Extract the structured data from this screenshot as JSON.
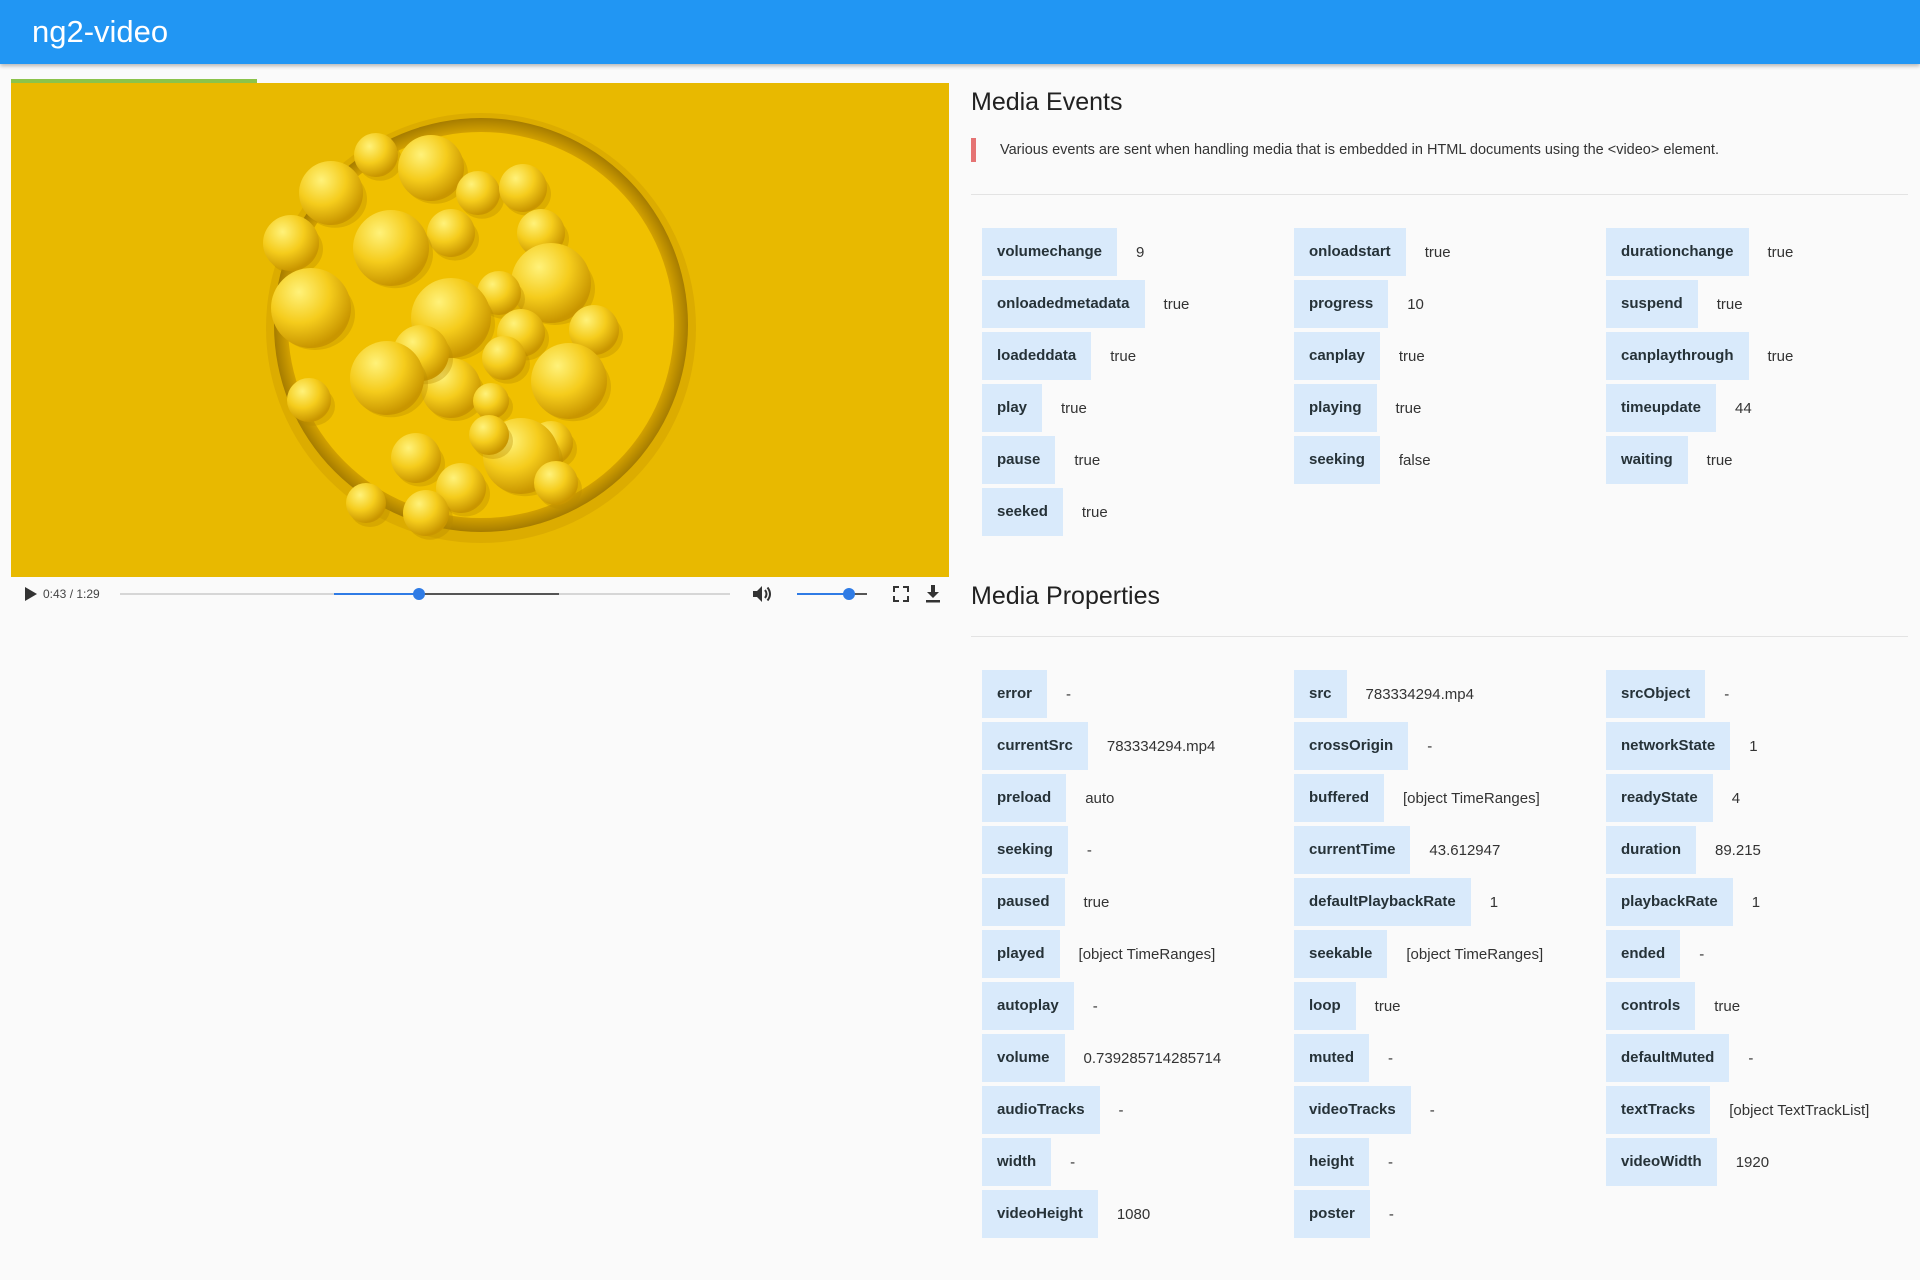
{
  "app": {
    "title": "ng2-video"
  },
  "player": {
    "time_display": "0:43 / 1:29",
    "progress": 0.49,
    "buffered_start": 0.35,
    "buffered_end": 0.72,
    "volume": 0.74
  },
  "events": {
    "title": "Media Events",
    "description": "Various events are sent when handling media that is embedded in HTML documents using the <video> element.",
    "columns": [
      [
        {
          "key": "volumechange",
          "value": "9"
        },
        {
          "key": "onloadedmetadata",
          "value": "true"
        },
        {
          "key": "loadeddata",
          "value": "true"
        },
        {
          "key": "play",
          "value": "true"
        },
        {
          "key": "pause",
          "value": "true"
        },
        {
          "key": "seeked",
          "value": "true"
        }
      ],
      [
        {
          "key": "onloadstart",
          "value": "true"
        },
        {
          "key": "progress",
          "value": "10"
        },
        {
          "key": "canplay",
          "value": "true"
        },
        {
          "key": "playing",
          "value": "true"
        },
        {
          "key": "seeking",
          "value": "false"
        }
      ],
      [
        {
          "key": "durationchange",
          "value": "true"
        },
        {
          "key": "suspend",
          "value": "true"
        },
        {
          "key": "canplaythrough",
          "value": "true"
        },
        {
          "key": "timeupdate",
          "value": "44"
        },
        {
          "key": "waiting",
          "value": "true"
        }
      ]
    ]
  },
  "properties": {
    "title": "Media Properties",
    "columns": [
      [
        {
          "key": "error",
          "value": "-"
        },
        {
          "key": "currentSrc",
          "value": "783334294.mp4"
        },
        {
          "key": "preload",
          "value": "auto"
        },
        {
          "key": "seeking",
          "value": "-"
        },
        {
          "key": "paused",
          "value": "true"
        },
        {
          "key": "played",
          "value": "[object TimeRanges]"
        },
        {
          "key": "autoplay",
          "value": "-"
        },
        {
          "key": "volume",
          "value": "0.739285714285714"
        },
        {
          "key": "audioTracks",
          "value": "-"
        },
        {
          "key": "width",
          "value": "-"
        },
        {
          "key": "videoHeight",
          "value": "1080"
        }
      ],
      [
        {
          "key": "src",
          "value": "783334294.mp4"
        },
        {
          "key": "crossOrigin",
          "value": "-"
        },
        {
          "key": "buffered",
          "value": "[object TimeRanges]"
        },
        {
          "key": "currentTime",
          "value": "43.612947"
        },
        {
          "key": "defaultPlaybackRate",
          "value": "1"
        },
        {
          "key": "seekable",
          "value": "[object TimeRanges]"
        },
        {
          "key": "loop",
          "value": "true"
        },
        {
          "key": "muted",
          "value": "-"
        },
        {
          "key": "videoTracks",
          "value": "-"
        },
        {
          "key": "height",
          "value": "-"
        },
        {
          "key": "poster",
          "value": "-"
        }
      ],
      [
        {
          "key": "srcObject",
          "value": "-"
        },
        {
          "key": "networkState",
          "value": "1"
        },
        {
          "key": "readyState",
          "value": "4"
        },
        {
          "key": "duration",
          "value": "89.215"
        },
        {
          "key": "playbackRate",
          "value": "1"
        },
        {
          "key": "ended",
          "value": "-"
        },
        {
          "key": "controls",
          "value": "true"
        },
        {
          "key": "defaultMuted",
          "value": "-"
        },
        {
          "key": "textTracks",
          "value": "[object TextTrackList]"
        },
        {
          "key": "videoWidth",
          "value": "1920"
        }
      ]
    ]
  },
  "icons": {
    "play": "play-icon",
    "volume": "volume-icon",
    "fullscreen": "fullscreen-icon",
    "download": "download-icon"
  },
  "colors": {
    "appbar": "#2196f3",
    "key_chip": "#d9eafb",
    "accent": "#2f7be5",
    "quote_border": "#e57373",
    "load_bar": "#8bc34a",
    "video_bg": "#e6b800"
  }
}
